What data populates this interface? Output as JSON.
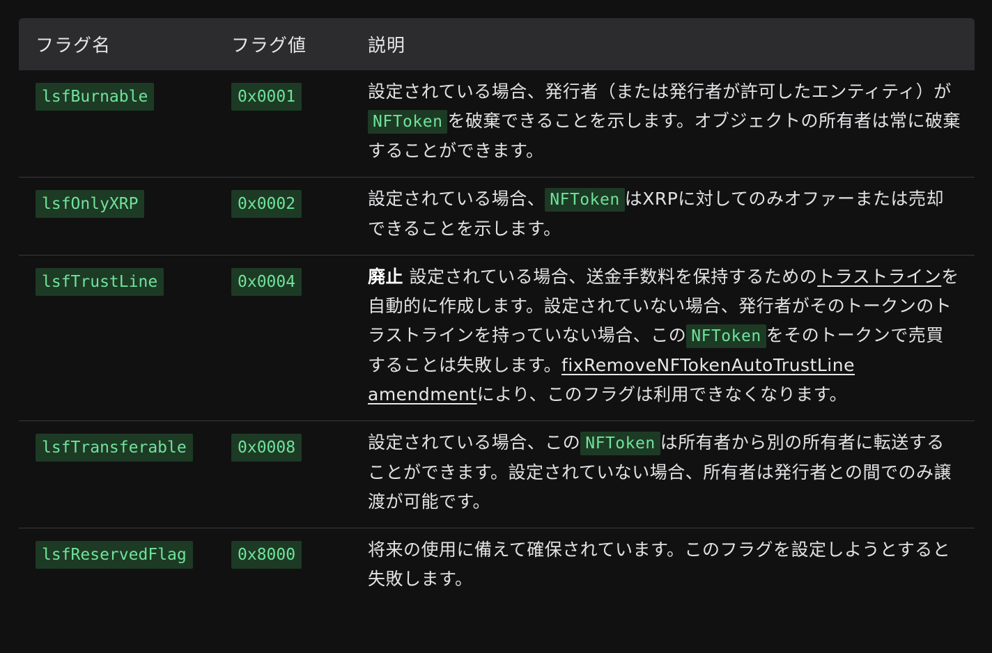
{
  "table": {
    "headers": [
      "フラグ名",
      "フラグ値",
      "説明"
    ],
    "rows": [
      {
        "name": "lsfBurnable",
        "value": "0x0001",
        "desc": {
          "p1": "設定されている場合、発行者（または発行者が許可したエンティティ）が",
          "code1": "NFToken",
          "p2": "を破棄できることを示します。オブジェクトの所有者は常に破棄することができます。"
        }
      },
      {
        "name": "lsfOnlyXRP",
        "value": "0x0002",
        "desc": {
          "p1": "設定されている場合、",
          "code1": "NFToken",
          "p2": "はXRPに対してのみオファーまたは売却できることを示します。"
        }
      },
      {
        "name": "lsfTrustLine",
        "value": "0x0004",
        "desc": {
          "strong": "廃止",
          "p1": " 設定されている場合、送金手数料を保持するための",
          "link1": "トラストライン",
          "p2": "を自動的に作成します。設定されていない場合、発行者がそのトークンのトラストラインを持っていない場合、この",
          "code1": "NFToken",
          "p3": "をそのトークンで売買することは失敗します。",
          "link2": "fixRemoveNFTokenAutoTrustLine amendment",
          "p4": "により、このフラグは利用できなくなります。"
        }
      },
      {
        "name": "lsfTransferable",
        "value": "0x0008",
        "desc": {
          "p1": "設定されている場合、この",
          "code1": "NFToken",
          "p2": "は所有者から別の所有者に転送することができます。設定されていない場合、所有者は発行者との間でのみ譲渡が可能です。"
        }
      },
      {
        "name": "lsfReservedFlag",
        "value": "0x8000",
        "desc": {
          "p1": "将来の使用に備えて確保されています。このフラグを設定しようとすると失敗します。"
        }
      }
    ]
  },
  "colors": {
    "background": "#111112",
    "header_bg": "#2c2c2f",
    "code_text": "#6fe39a",
    "code_bg": "#1d3a25"
  }
}
